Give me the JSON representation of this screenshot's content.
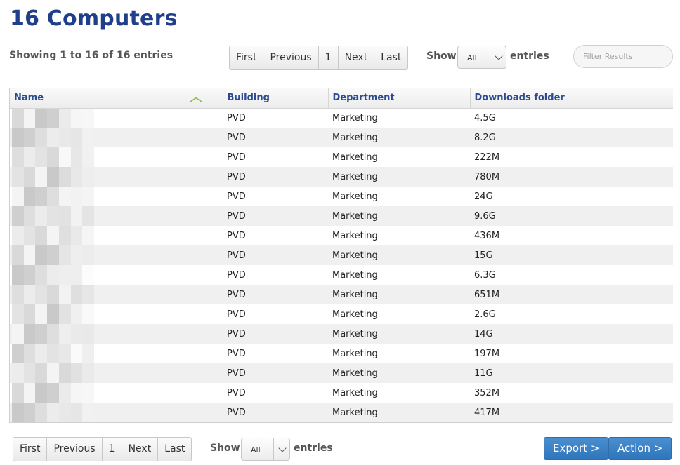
{
  "page": {
    "title": "16 Computers"
  },
  "info": {
    "showing": "Showing 1 to 16 of 16 entries"
  },
  "pagination": {
    "first": "First",
    "previous": "Previous",
    "page": "1",
    "next": "Next",
    "last": "Last"
  },
  "length": {
    "show_label": "Show",
    "entries_label": "entries",
    "selected": "All"
  },
  "filter": {
    "placeholder": "Filter Results",
    "value": ""
  },
  "table": {
    "columns": [
      "Name",
      "Building",
      "Department",
      "Downloads folder"
    ],
    "sorted_column": "Name",
    "sort_direction": "ascending",
    "rows": [
      {
        "name": "",
        "building": "PVD",
        "department": "Marketing",
        "downloads": "4.5G"
      },
      {
        "name": "",
        "building": "PVD",
        "department": "Marketing",
        "downloads": "8.2G"
      },
      {
        "name": "",
        "building": "PVD",
        "department": "Marketing",
        "downloads": "222M"
      },
      {
        "name": "",
        "building": "PVD",
        "department": "Marketing",
        "downloads": "780M"
      },
      {
        "name": "",
        "building": "PVD",
        "department": "Marketing",
        "downloads": "24G"
      },
      {
        "name": "",
        "building": "PVD",
        "department": "Marketing",
        "downloads": "9.6G"
      },
      {
        "name": "",
        "building": "PVD",
        "department": "Marketing",
        "downloads": "436M"
      },
      {
        "name": "",
        "building": "PVD",
        "department": "Marketing",
        "downloads": "15G"
      },
      {
        "name": "",
        "building": "PVD",
        "department": "Marketing",
        "downloads": "6.3G"
      },
      {
        "name": "",
        "building": "PVD",
        "department": "Marketing",
        "downloads": "651M"
      },
      {
        "name": "",
        "building": "PVD",
        "department": "Marketing",
        "downloads": "2.6G"
      },
      {
        "name": "",
        "building": "PVD",
        "department": "Marketing",
        "downloads": "14G"
      },
      {
        "name": "",
        "building": "PVD",
        "department": "Marketing",
        "downloads": "197M"
      },
      {
        "name": "",
        "building": "PVD",
        "department": "Marketing",
        "downloads": "11G"
      },
      {
        "name": "",
        "building": "PVD",
        "department": "Marketing",
        "downloads": "352M"
      },
      {
        "name": "",
        "building": "PVD",
        "department": "Marketing",
        "downloads": "417M"
      }
    ]
  },
  "actions": {
    "export": "Export >",
    "action": "Action >"
  },
  "colors": {
    "title": "#1f3f8a",
    "header_text": "#2b4a8f",
    "sort_icon": "#8dbb3c",
    "button_blue": "#3a80c4"
  },
  "icons": {
    "sort": "chevron-up-icon",
    "select": "chevron-down-icon"
  }
}
